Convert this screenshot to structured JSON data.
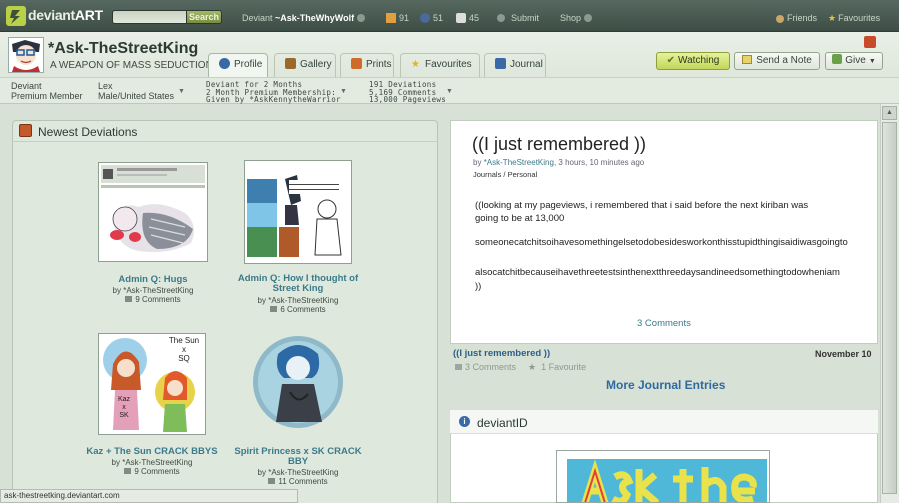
{
  "topbar": {
    "logo_text_a": "deviant",
    "logo_text_b": "ART",
    "search_placeholder": "",
    "search_label": "Search",
    "user_prefix": "Deviant",
    "user_name": "~Ask-TheWhyWolf",
    "stat1": "91",
    "stat2": "51",
    "stat3": "45",
    "submit": "Submit",
    "shop": "Shop",
    "friends": "Friends",
    "favourites": "Favourites"
  },
  "header": {
    "username": "*Ask-TheStreetKing",
    "tagline": "A WEAPON OF MASS SEDUCTION",
    "tabs": [
      {
        "label": "Profile",
        "active": true
      },
      {
        "label": "Gallery"
      },
      {
        "label": "Prints"
      },
      {
        "label": "Favourites"
      },
      {
        "label": "Journal"
      }
    ],
    "watching": "Watching",
    "send_note": "Send a Note",
    "give": "Give"
  },
  "profile_strip": {
    "line1a": "Deviant",
    "line1b": "Premium Member",
    "line2a": "Lex",
    "line2b": "Male/United States",
    "line3a": "Deviant for 2 Months",
    "line3b": "2 Month Premium Membership:",
    "line3c": "Given by *AskKennytheWarrior",
    "line4a": "191 Deviations",
    "line4b": "5,169 Comments",
    "line4c": "13,000 Pageviews"
  },
  "newest_deviations": {
    "title": "Newest Deviations",
    "items": [
      {
        "title": "Admin Q: Hugs",
        "by": "by *Ask-TheStreetKing",
        "comments": "9 Comments"
      },
      {
        "title": "Admin Q: How I thought of Street King",
        "by": "by *Ask-TheStreetKing",
        "comments": "6 Comments"
      },
      {
        "title": "Kaz + The Sun CRACK BBYS",
        "by": "by *Ask-TheStreetKing",
        "comments": "9 Comments"
      },
      {
        "title": "Spirit Princess x SK CRACK BBY",
        "by": "by *Ask-TheStreetKing",
        "comments": "11 Comments"
      }
    ],
    "thumb_texts": {
      "sun": "The Sun",
      "x1": "x",
      "sq": "SQ",
      "kaz": "Kaz",
      "x2": "x",
      "sk": "SK"
    }
  },
  "journal": {
    "title": "((I just remembered ))",
    "meta_by": "by",
    "meta_user": "*Ask-TheStreetKing",
    "meta_time": ", 3 hours, 10 minutes ago",
    "cats": "Journals / Personal",
    "p1a": "((looking at my pageviews, i remembered that i said before the next kiriban was",
    "p1b": "going to be at 13,000",
    "p2": "someonecatchitsoihavesomethingelsetodobesidesworkonthisstupidthingisaidiwasgoingto",
    "p3a": "alsocatchitbecauseihavethreetestsinthenextthreedaysandineedsomethingtodowheniam",
    "p3b": "))",
    "comments_link": "3 Comments",
    "entry_title": "((I just remembered ))",
    "entry_date": "November 10",
    "entry_comments": "3 Comments",
    "entry_fav": "1 Favourite",
    "more": "More Journal Entries"
  },
  "deviantid": {
    "title": "deviantID"
  },
  "status_bar": "ask-thestreetking.deviantart.com"
}
